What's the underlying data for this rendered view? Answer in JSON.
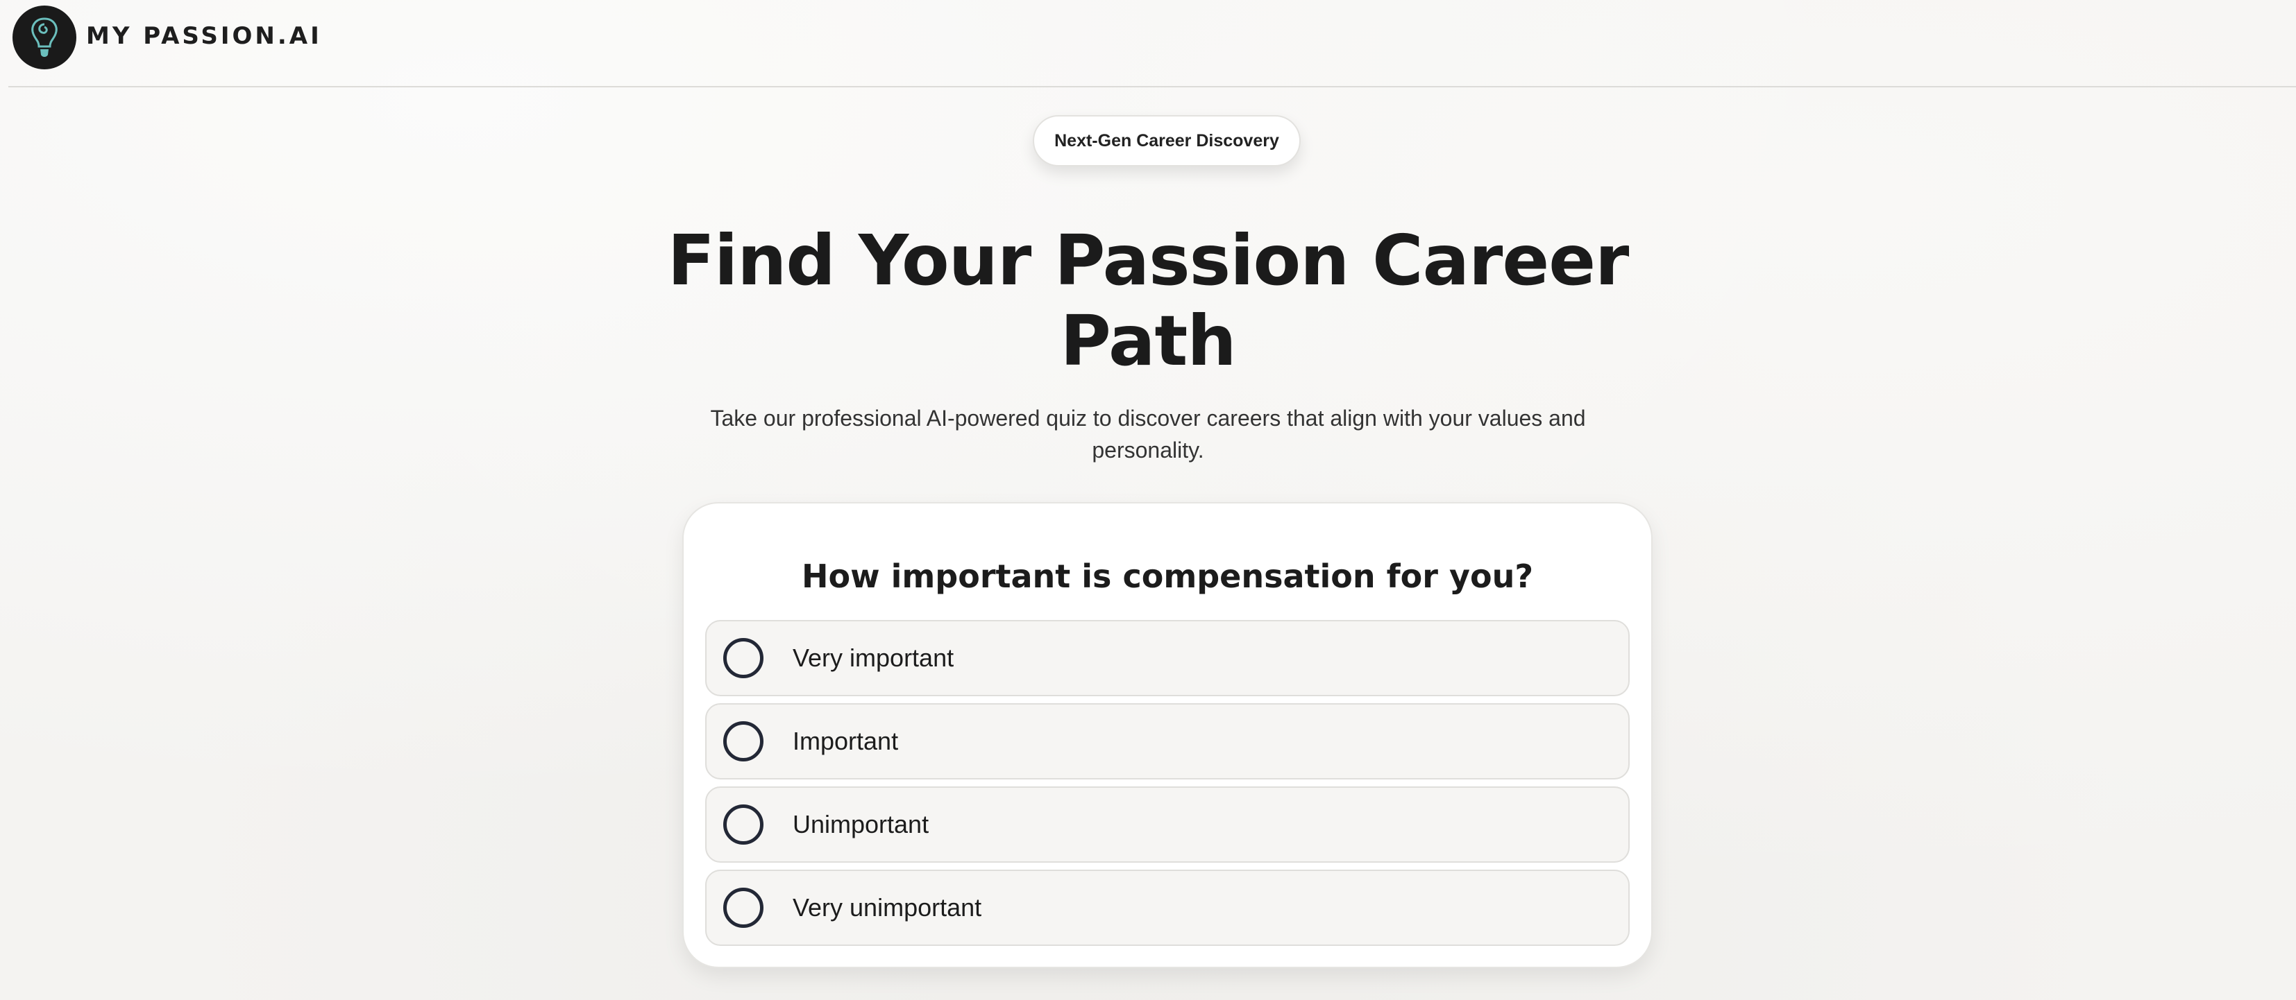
{
  "header": {
    "brand": "MY PASSION.AI",
    "logo_icon": "lightbulb-swirl-icon"
  },
  "hero": {
    "badge": "Next-Gen Career Discovery",
    "title": "Find Your Passion Career Path",
    "subtitle": "Take our professional AI-powered quiz to discover careers that align with your values and personality."
  },
  "quiz": {
    "question": "How important is compensation for you?",
    "options": [
      {
        "label": "Very important",
        "selected": false
      },
      {
        "label": "Important",
        "selected": false
      },
      {
        "label": "Unimportant",
        "selected": false
      },
      {
        "label": "Very unimportant",
        "selected": false
      }
    ]
  },
  "colors": {
    "background": "#f4f3f1",
    "text": "#1c1c1c",
    "radio_border": "#232836",
    "logo_accent": "#6bbfbd"
  }
}
